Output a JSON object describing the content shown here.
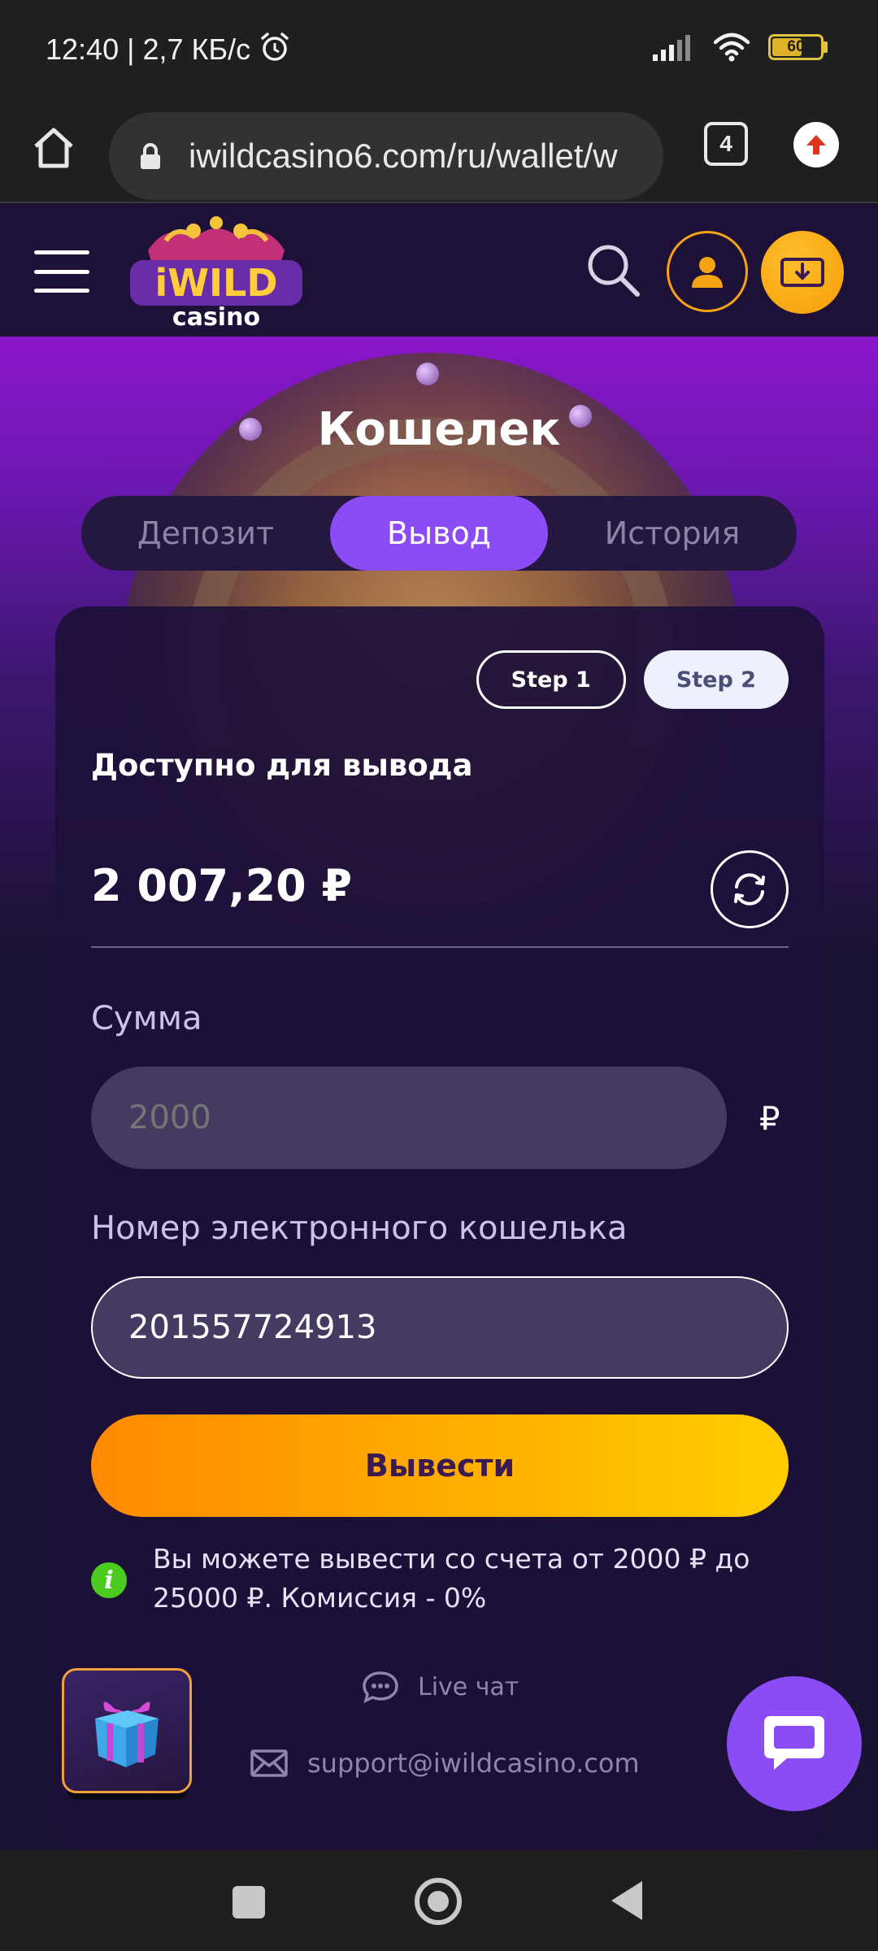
{
  "status": {
    "time_speed": "12:40 | 2,7 КБ/с",
    "battery": "60"
  },
  "browser": {
    "url": "iwildcasino6.com/ru/wallet/w",
    "tab_count": "4"
  },
  "header": {
    "logo_top": "iWILD",
    "logo_bottom": "casino"
  },
  "page": {
    "title": "Кошелек",
    "tabs": [
      {
        "label": "Депозит"
      },
      {
        "label": "Вывод"
      },
      {
        "label": "История"
      }
    ]
  },
  "wallet": {
    "step1": "Step 1",
    "step2": "Step 2",
    "available_label": "Доступно для вывода",
    "balance": "2 007,20 ₽",
    "amount_label": "Сумма",
    "amount_value": "2000",
    "currency": "₽",
    "wallet_label": "Номер электронного кошелька",
    "wallet_value": "201557724913",
    "withdraw_button": "Вывести",
    "info_text": "Вы можете вывести со счета от 2000 ₽ до 25000 ₽. Комиссия - 0%",
    "live_chat": "Live чат",
    "support_email": "support@iwildcasino.com"
  },
  "colors": {
    "accent_purple": "#8b4cf6",
    "accent_orange": "#f6a313",
    "card_bg": "#1d103a"
  }
}
